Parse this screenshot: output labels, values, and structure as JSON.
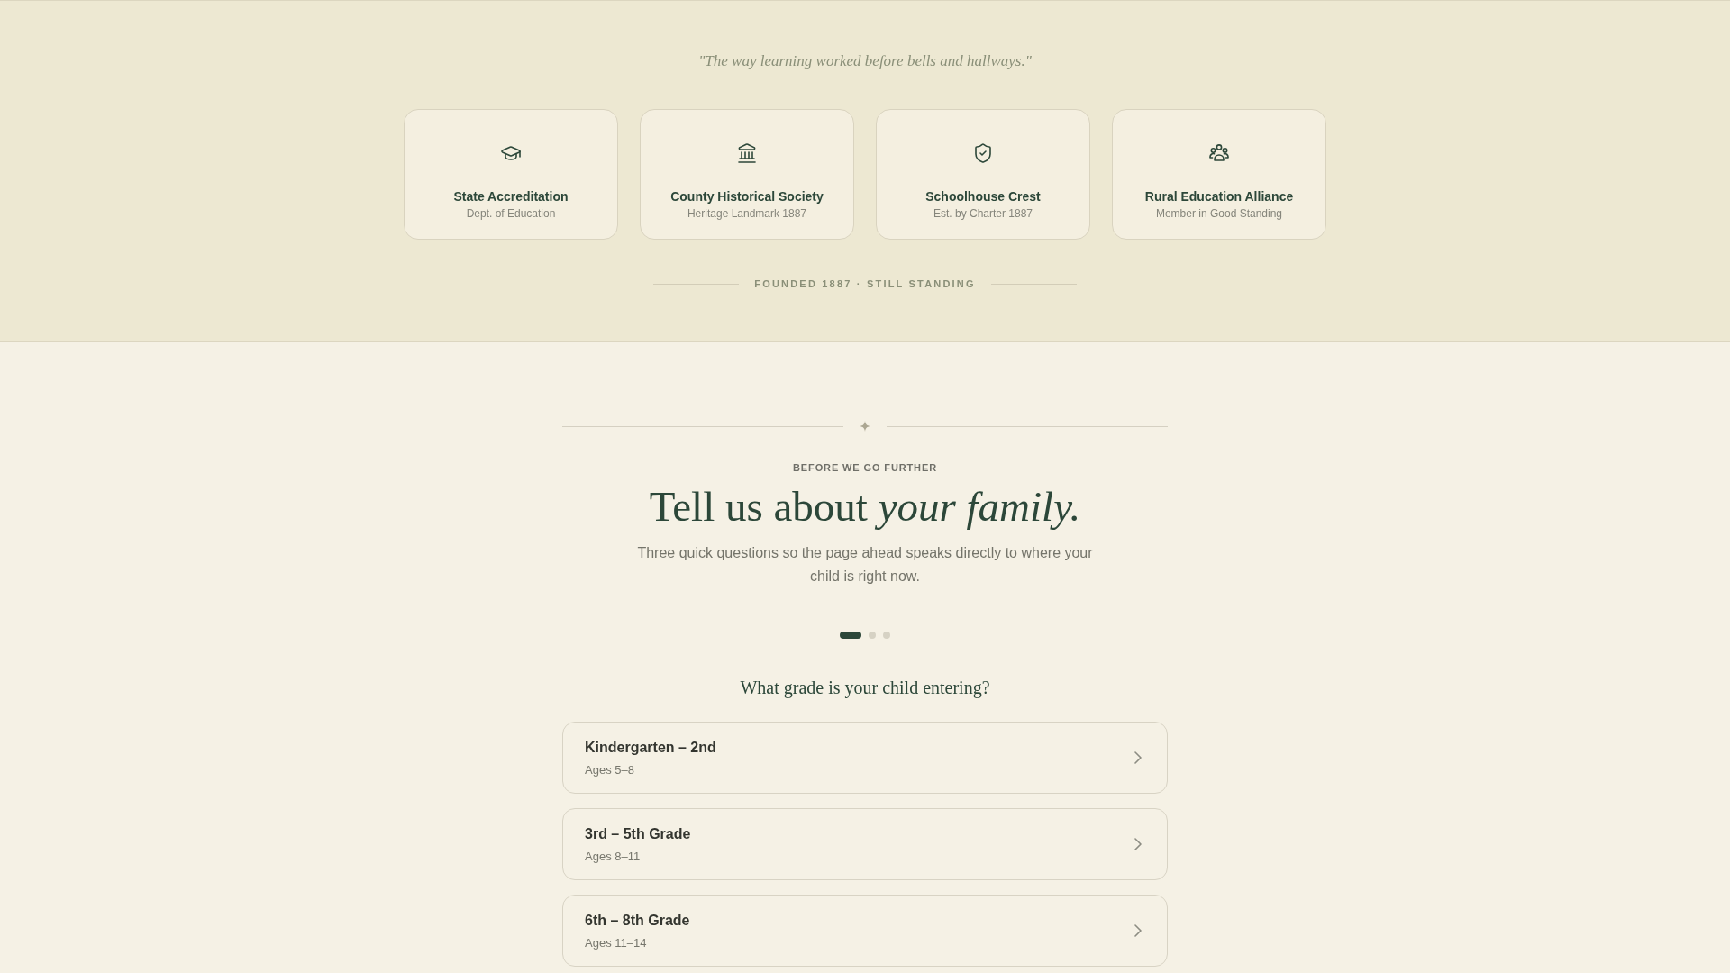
{
  "quote": "\"The way learning worked before bells and hallways.\"",
  "credentials": [
    {
      "title": "State Accreditation",
      "subtitle": "Dept. of Education"
    },
    {
      "title": "County Historical Society",
      "subtitle": "Heritage Landmark 1887"
    },
    {
      "title": "Schoolhouse Crest",
      "subtitle": "Est. by Charter 1887"
    },
    {
      "title": "Rural Education Alliance",
      "subtitle": "Member in Good Standing"
    }
  ],
  "founded_label": "FOUNDED 1887 · STILL STANDING",
  "intro": {
    "eyebrow": "BEFORE WE GO FURTHER",
    "heading": "Tell us about *your family.*",
    "description": "Three quick questions so the page ahead speaks directly to where your child is right now."
  },
  "progress": {
    "steps": [
      {
        "selected": true
      },
      {
        "selected": false
      },
      {
        "selected": false
      }
    ]
  },
  "question": {
    "prompt": "What grade is your child entering?",
    "options": [
      {
        "title": "Kindergarten – 2nd",
        "subtitle": "Ages 5–8",
        "selected": false
      },
      {
        "title": "3rd – 5th Grade",
        "subtitle": "Ages 8–11",
        "selected": false
      },
      {
        "title": "6th – 8th Grade",
        "subtitle": "Ages 11–14",
        "selected": false
      }
    ]
  }
}
